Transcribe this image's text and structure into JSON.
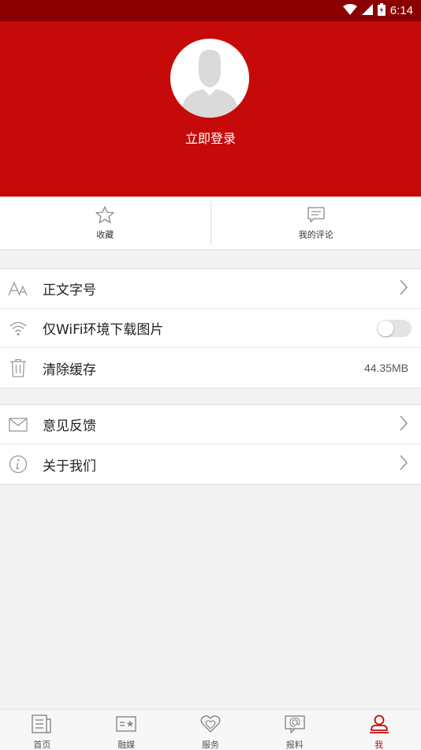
{
  "status_bar": {
    "time": "6:14"
  },
  "profile": {
    "login_label": "立即登录"
  },
  "quick_actions": [
    {
      "label": "收藏",
      "icon": "star-icon"
    },
    {
      "label": "我的评论",
      "icon": "comment-icon"
    }
  ],
  "settings": {
    "font_size_label": "正文字号",
    "wifi_image_label": "仅WiFi环境下载图片",
    "wifi_image_enabled": false,
    "clear_cache_label": "清除缓存",
    "cache_size": "44.35MB"
  },
  "info": {
    "feedback_label": "意见反馈",
    "about_label": "关于我们"
  },
  "tabs": [
    {
      "label": "首页",
      "icon": "news-icon",
      "active": false
    },
    {
      "label": "融媒",
      "icon": "media-icon",
      "active": false
    },
    {
      "label": "服务",
      "icon": "service-heart-icon",
      "active": false
    },
    {
      "label": "报料",
      "icon": "report-icon",
      "active": false
    },
    {
      "label": "我",
      "icon": "user-icon",
      "active": true
    }
  ],
  "colors": {
    "brand_red": "#c60a0a",
    "status_bar": "#8b0000"
  }
}
